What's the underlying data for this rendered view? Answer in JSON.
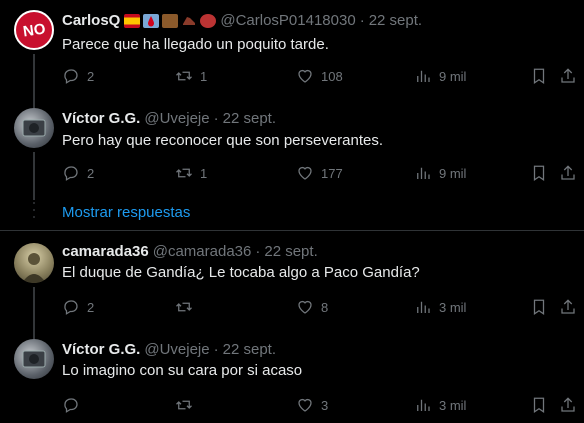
{
  "tweets": [
    {
      "name": "CarlosQ",
      "handle": "@CarlosP01418030",
      "date": "22 sept.",
      "text": "Parece que ha llegado un poquito tarde.",
      "replies": "2",
      "retweets": "1",
      "likes": "108",
      "views": "9 mil",
      "avatar_text": "NO"
    },
    {
      "name": "Víctor G.G.",
      "handle": "@Uvejeje",
      "date": "22 sept.",
      "text": "Pero hay que reconocer que son perseverantes.",
      "replies": "2",
      "retweets": "1",
      "likes": "177",
      "views": "9 mil"
    },
    {
      "name": "camarada36",
      "handle": "@camarada36",
      "date": "22 sept.",
      "text": "El duque de Gandía¿ Le tocaba algo a Paco Gandía?",
      "replies": "2",
      "retweets": "",
      "likes": "8",
      "views": "3 mil"
    },
    {
      "name": "Víctor G.G.",
      "handle": "@Uvejeje",
      "date": "22 sept.",
      "text": "Lo imagino con su cara por si acaso",
      "replies": "",
      "retweets": "",
      "likes": "3",
      "views": "3 mil"
    }
  ],
  "show_more_label": "Mostrar respuestas",
  "separator": "·",
  "colors": {
    "background": "#000000",
    "text": "#e7e9ea",
    "muted": "#71767b",
    "link": "#1d9bf0",
    "divider": "#2f3336"
  },
  "icons": [
    "reply-icon",
    "retweet-icon",
    "like-icon",
    "views-icon",
    "bookmark-icon",
    "share-icon"
  ]
}
